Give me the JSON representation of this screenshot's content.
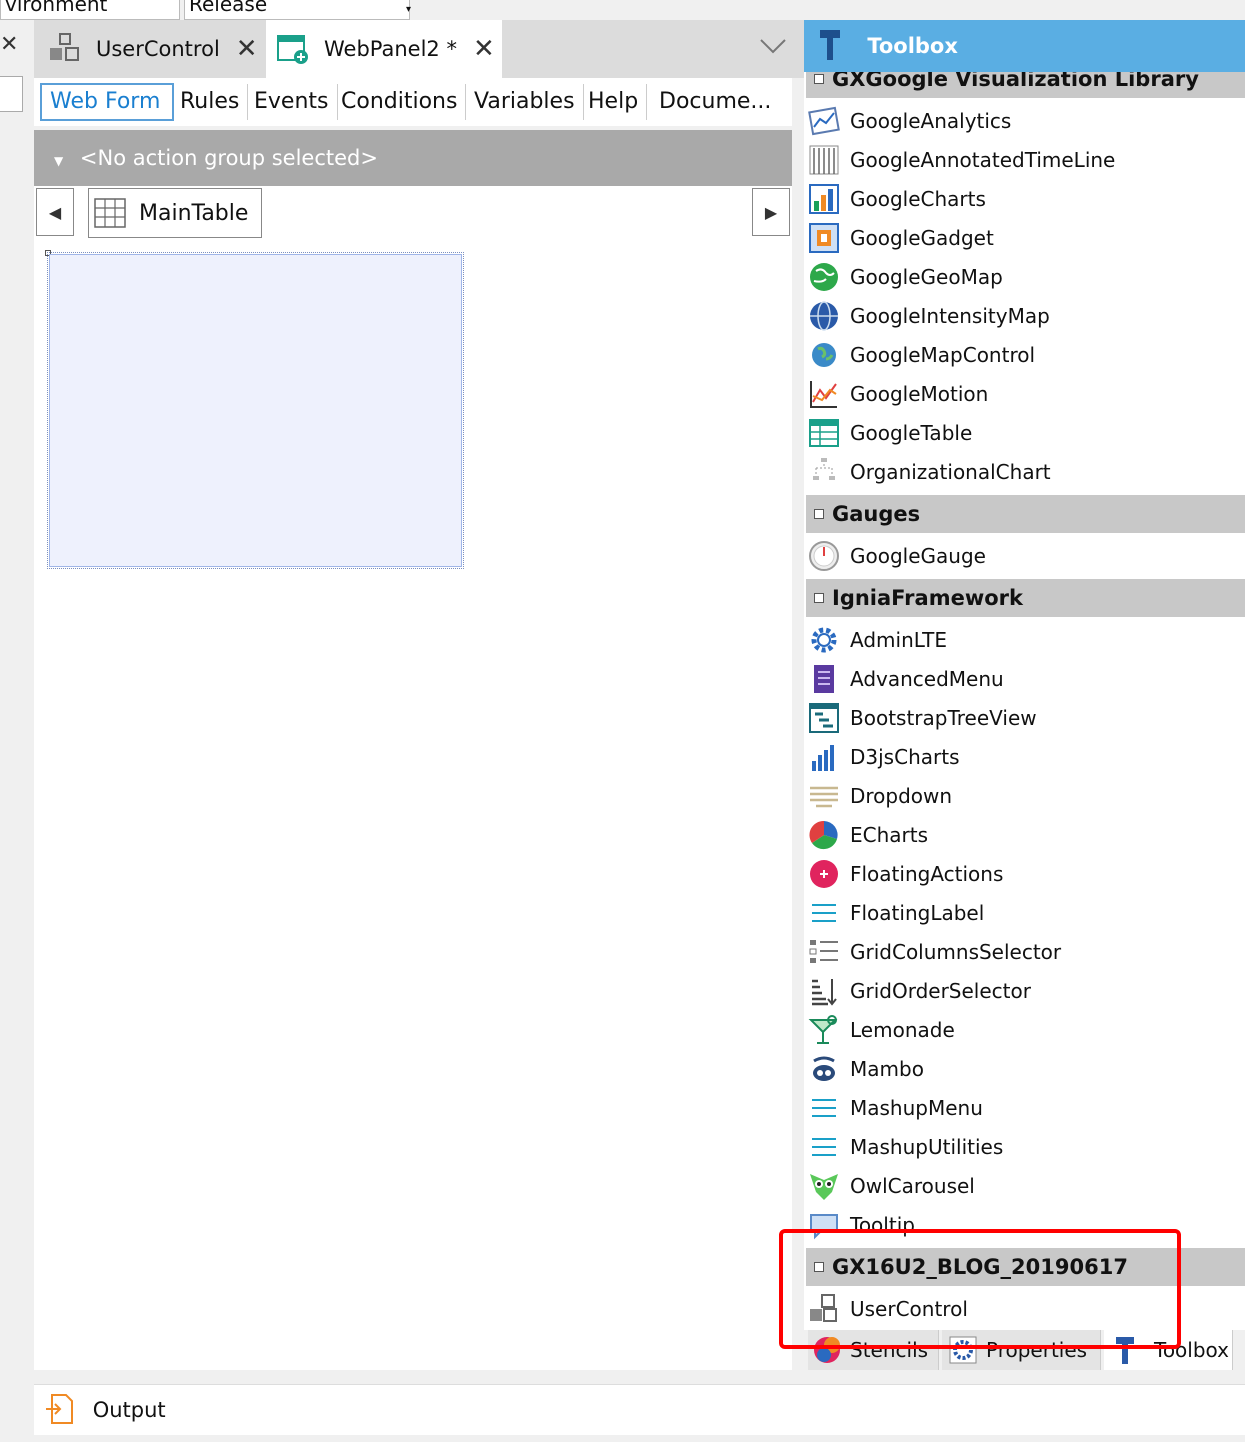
{
  "env": {
    "environment_label": "vironment",
    "release_label": "Release"
  },
  "doc_tabs": [
    {
      "label": "UserControl",
      "close": "✕"
    },
    {
      "label": "WebPanel2 *",
      "close": "✕"
    }
  ],
  "sub_tabs": [
    "Web Form",
    "Rules",
    "Events",
    "Conditions",
    "Variables",
    "Help",
    "Docume..."
  ],
  "action_group": "<No action group selected>",
  "breadcrumb_table": "MainTable",
  "toolbox": {
    "title": "Toolbox",
    "categories": [
      {
        "name": "GXGoogle Visualization Library",
        "items": [
          "GoogleAnalytics",
          "GoogleAnnotatedTimeLine",
          "GoogleCharts",
          "GoogleGadget",
          "GoogleGeoMap",
          "GoogleIntensityMap",
          "GoogleMapControl",
          "GoogleMotion",
          "GoogleTable",
          "OrganizationalChart"
        ]
      },
      {
        "name": "Gauges",
        "items": [
          "GoogleGauge"
        ]
      },
      {
        "name": "IgniaFramework",
        "items": [
          "AdminLTE",
          "AdvancedMenu",
          "BootstrapTreeView",
          "D3jsCharts",
          "Dropdown",
          "ECharts",
          "FloatingActions",
          "FloatingLabel",
          "GridColumnsSelector",
          "GridOrderSelector",
          "Lemonade",
          "Mambo",
          "MashupMenu",
          "MashupUtilities",
          "OwlCarousel",
          "Tooltip"
        ]
      },
      {
        "name": "GX16U2_BLOG_20190617",
        "items": [
          "UserControl"
        ]
      }
    ],
    "bottom_tabs": [
      "Stencils",
      "Properties",
      "Toolbox"
    ]
  },
  "output": {
    "label": "Output"
  },
  "colors": {
    "accent": "#5aaee3",
    "highlight": "#ff0000",
    "selected_tab": "#1a7fd0"
  }
}
